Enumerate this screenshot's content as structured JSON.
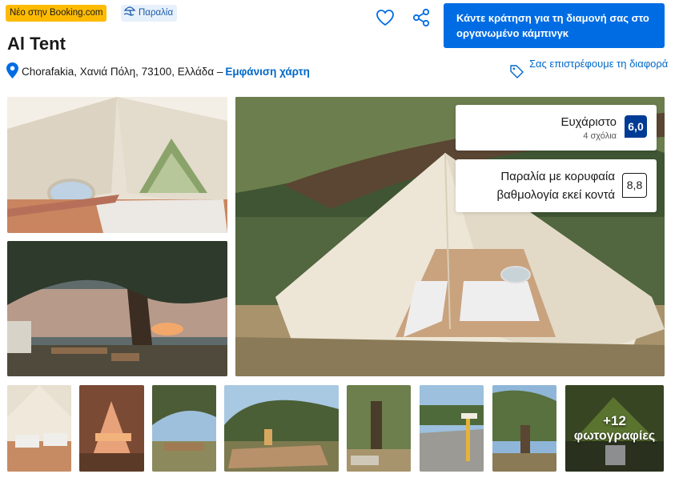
{
  "badges": {
    "new_on_booking": "Νέο στην Booking.com",
    "beach": "Παραλία"
  },
  "property": {
    "name": "Al Tent",
    "address": "Chorafakia, Χανιά Πόλη, 73100, Ελλάδα –",
    "map_link": "Εμφάνιση χάρτη"
  },
  "actions": {
    "reserve_label": "Κάντε κράτηση για τη διαμονή σας στο οργανωμένο κάμπινγκ",
    "price_match": "Σας επιστρέφουμε τη διαφορά",
    "favorite_icon": "heart-icon",
    "share_icon": "share-icon"
  },
  "rating": {
    "word": "Ευχάριστο",
    "reviews": "4 σχόλια",
    "score": "6,0"
  },
  "beach_rating": {
    "label": "Παραλία με κορυφαία βαθμολογία εκεί κοντά",
    "score": "8,8"
  },
  "gallery": {
    "more_count": "+12",
    "more_label": "φωτογραφίες"
  },
  "colors": {
    "brand_blue": "#006ce4",
    "score_dark_blue": "#003b95",
    "link_blue": "#0068c8",
    "badge_yellow": "#febb02"
  }
}
